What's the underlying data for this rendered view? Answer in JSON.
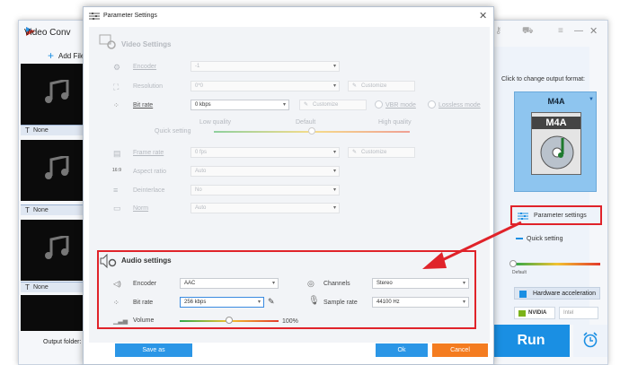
{
  "app": {
    "title": "Video Conv",
    "add_file": "Add File",
    "thumbnails": [
      {
        "subtitle": "None"
      },
      {
        "subtitle": "None"
      },
      {
        "subtitle": "None"
      }
    ],
    "output_folder_label": "Output folder:",
    "format_hint": "Click to change output format:",
    "format_name": "M4A",
    "format_disc_label": "M4A",
    "parameter_settings": "Parameter settings",
    "quick_setting": "Quick setting",
    "quick_default": "Default",
    "hardware_acceleration": "Hardware acceleration",
    "nvidia": "NVIDIA",
    "intel": "Intel",
    "run": "Run"
  },
  "dialog": {
    "title": "Parameter Settings",
    "video": {
      "section_title": "Video Settings",
      "encoder_label": "Encoder",
      "encoder_value": "-1",
      "resolution_label": "Resolution",
      "resolution_value": "0*0",
      "resolution_customize": "Customize",
      "bitrate_label": "Bit rate",
      "bitrate_value": "0 kbps",
      "bitrate_customize": "Customize",
      "vbr_mode": "VBR mode",
      "lossless_mode": "Lossless mode",
      "quality_low": "Low quality",
      "quality_default": "Default",
      "quality_high": "High quality",
      "quick_setting": "Quick setting",
      "quality_level": 0.5,
      "framerate_label": "Frame rate",
      "framerate_value": "0 fps",
      "framerate_customize": "Customize",
      "aspect_label": "Aspect ratio",
      "aspect_value": "Auto",
      "deinterlace_label": "Deinterlace",
      "deinterlace_value": "No",
      "norm_label": "Norm",
      "norm_value": "Auto"
    },
    "audio": {
      "section_title": "Audio settings",
      "encoder_label": "Encoder",
      "encoder_value": "AAC",
      "channels_label": "Channels",
      "channels_value": "Stereo",
      "bitrate_label": "Bit rate",
      "bitrate_value": "256 kbps",
      "samplerate_label": "Sample rate",
      "samplerate_value": "44100 Hz",
      "volume_label": "Volume",
      "volume_value": "100%",
      "volume_level": 0.5
    },
    "save_as": "Save as",
    "ok": "Ok",
    "cancel": "Cancel"
  },
  "colors": {
    "highlight_red": "#e0232a",
    "run_blue": "#1a8fe3",
    "cancel_orange": "#f47c20",
    "format_blue": "#8ec5ef"
  }
}
